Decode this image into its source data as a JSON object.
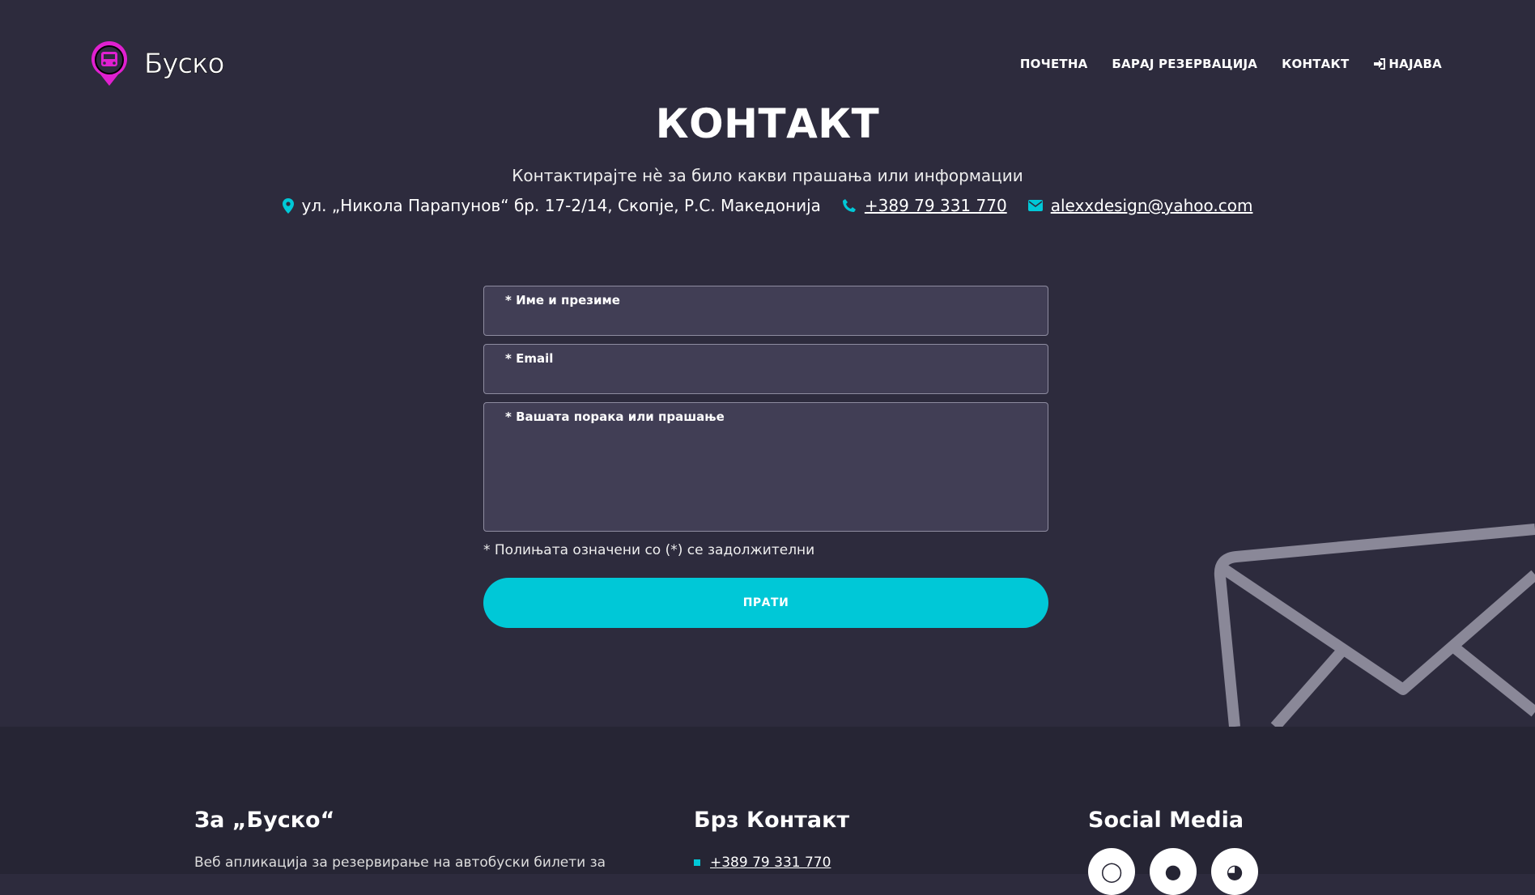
{
  "header": {
    "logo_text": "Буско",
    "nav": {
      "home": "ПОЧЕТНА",
      "search": "БАРАЈ РЕЗЕРВАЦИЈА",
      "contact": "КОНТАКТ",
      "login": "НАЈАВА"
    }
  },
  "main": {
    "title": "КОНТАКТ",
    "subtitle": "Контактирајте нѐ за било какви прашања или информации",
    "address": "ул. „Никола Парапунов“ бр. 17-2/14, Скопје, Р.С. Македонија",
    "phone": "+389 79 331 770",
    "email": "alexxdesign@yahoo.com"
  },
  "form": {
    "name_label": "* Име и презиме",
    "email_label": "* Email",
    "message_label": "* Вашата порака или прашање",
    "note": "* Полињата означени со (*) се задолжителни",
    "submit": "ПРАТИ"
  },
  "footer": {
    "about_title": "За „Буско“",
    "about_text": "Веб апликација за резервирање на автобуски билети за",
    "quick_title": "Брз Контакт",
    "quick_phone": "+389 79 331 770",
    "social_title": "Social Media"
  },
  "colors": {
    "background": "#2d2b3d",
    "accent": "#00c8d7",
    "brand": "#e020d0",
    "footer": "#262534"
  },
  "icons": [
    "bus-pin-logo-icon",
    "sign-in-icon",
    "map-marker-icon",
    "phone-icon",
    "envelope-icon",
    "instagram-icon",
    "github-icon",
    "globe-icon"
  ]
}
